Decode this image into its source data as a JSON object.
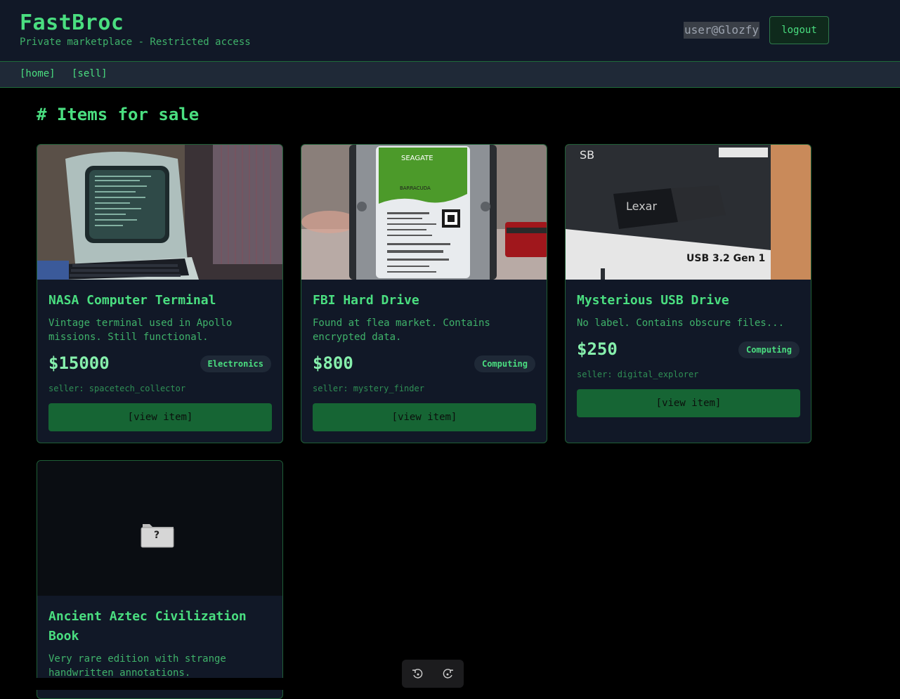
{
  "header": {
    "title": "FastBroc",
    "subtitle": "Private marketplace - Restricted access",
    "user": "user@Glozfy",
    "logout_label": "logout"
  },
  "nav": {
    "home": "[home]",
    "sell": "[sell]"
  },
  "page": {
    "heading": "# Items for sale"
  },
  "items": [
    {
      "title": "NASA Computer Terminal",
      "description": "Vintage terminal used in Apollo missions. Still functional.",
      "price": "$15000",
      "category": "Electronics",
      "seller": "seller: spacetech_collector",
      "button": "[view item]"
    },
    {
      "title": "FBI Hard Drive",
      "description": "Found at flea market. Contains encrypted data.",
      "price": "$800",
      "category": "Computing",
      "seller": "seller: mystery_finder",
      "button": "[view item]"
    },
    {
      "title": "Mysterious USB Drive",
      "description": "No label. Contains obscure files...",
      "price": "$250",
      "category": "Computing",
      "seller": "seller: digital_explorer",
      "button": "[view item]"
    },
    {
      "title": "Ancient Aztec Civilization Book",
      "description": "Very rare edition with strange handwritten annotations.",
      "placeholder_glyph": "?"
    }
  ],
  "images": {
    "item_1": "retro-terminal-photo",
    "item_2": "seagate-hard-drive-photo",
    "item_3": "usb-drive-photo",
    "item_4": "missing-image-folder-icon"
  },
  "toolbar": {
    "icons": [
      "rotate-left-icon",
      "rotate-right-icon"
    ]
  },
  "colors": {
    "accent": "#4ade80",
    "button_bg": "#166534",
    "card_bg": "#111827",
    "page_bg": "#000000"
  }
}
